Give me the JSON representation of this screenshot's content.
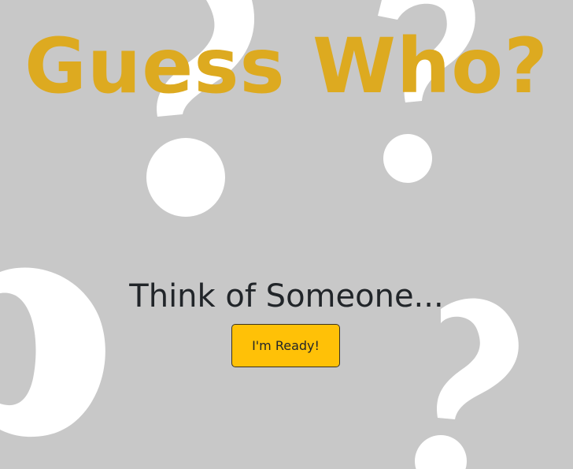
{
  "page": {
    "title": "Guess Who?",
    "subtitle": "Think of Someone...",
    "ready_button_label": "I'm Ready!",
    "background_color": "#c8c8c8",
    "title_color": "#ddaa20",
    "button_color": "#ffc107",
    "decoration": "question-mark-pattern"
  }
}
